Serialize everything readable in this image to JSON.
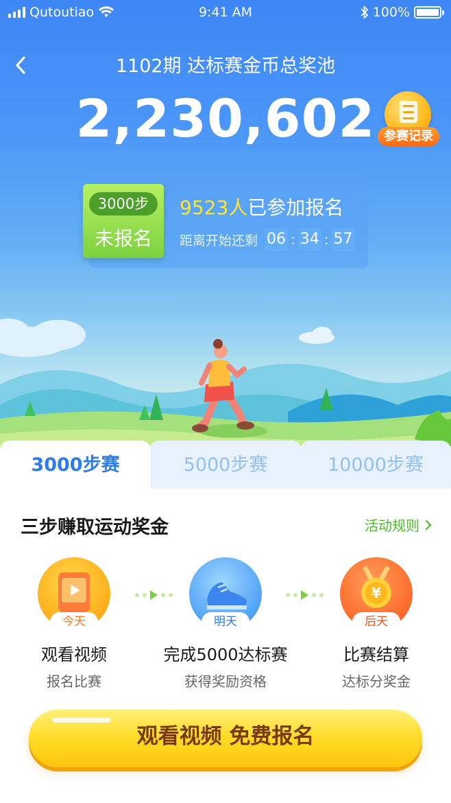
{
  "status_bar": {
    "carrier": "Qutoutiao",
    "time": "9:41 AM",
    "battery": "100%"
  },
  "header": {
    "title": "1102期  达标赛金币总奖池",
    "pool_amount": "2,230,602",
    "records_label": "参赛记录"
  },
  "entry": {
    "steps_badge": "3000步",
    "status": "未报名",
    "participants_count": "9523人",
    "participants_suffix": "已参加报名",
    "countdown_label": "距离开始还剩",
    "countdown": {
      "hours": "06",
      "minutes": "34",
      "seconds": "57"
    }
  },
  "tabs": [
    {
      "label": "3000步赛",
      "active": true
    },
    {
      "label": "5000步赛",
      "active": false
    },
    {
      "label": "10000步赛",
      "active": false
    }
  ],
  "guide": {
    "title": "三步赚取运动奖金",
    "rules_link": "活动规则",
    "steps": [
      {
        "tag": "今天",
        "name": "观看视频",
        "sub": "报名比赛",
        "icon": "video-phone-icon"
      },
      {
        "tag": "明天",
        "name": "完成5000达标赛",
        "sub": "获得奖励资格",
        "icon": "running-shoe-icon"
      },
      {
        "tag": "后天",
        "name": "比赛结算",
        "sub": "达标分奖金",
        "icon": "yuan-medal-icon"
      }
    ]
  },
  "cta": {
    "label": "观看视频 免费报名"
  },
  "colors": {
    "accent_blue": "#2e7bea",
    "green": "#4bbd2b",
    "gold": "#ffdd2a",
    "highlight_yellow": "#ffe336"
  }
}
